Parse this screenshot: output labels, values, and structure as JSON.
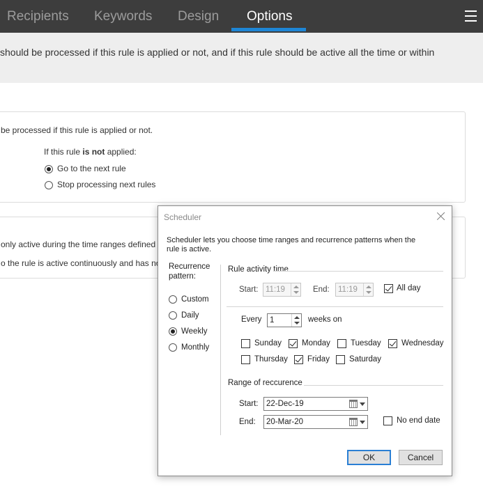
{
  "tabs": [
    {
      "label": "Recipients",
      "active": false
    },
    {
      "label": "Keywords",
      "active": false
    },
    {
      "label": "Design",
      "active": false
    },
    {
      "label": "Options",
      "active": true
    }
  ],
  "description": "should be processed if this rule is applied or not, and if this rule should be active all the time or within",
  "panel1": {
    "text": "be processed if this rule is applied or not.",
    "condition_prefix": "If this rule ",
    "condition_bold": "is not",
    "condition_suffix": " applied:",
    "options": [
      {
        "label": "Go to the next rule",
        "selected": true
      },
      {
        "label": "Stop processing next rules",
        "selected": false
      }
    ]
  },
  "panel2": {
    "line1": "only active during the time ranges defined",
    "line2": "o the rule is active continuously and has no"
  },
  "dialog": {
    "title": "Scheduler",
    "intro": "Scheduler lets you choose time ranges and recurrence patterns when the rule is active.",
    "recurrence_label": "Recurrence pattern:",
    "patterns": [
      {
        "label": "Custom",
        "selected": false
      },
      {
        "label": "Daily",
        "selected": false
      },
      {
        "label": "Weekly",
        "selected": true
      },
      {
        "label": "Monthly",
        "selected": false
      }
    ],
    "activity_time_label": "Rule activity time",
    "start_label": "Start:",
    "start_time": "11:19",
    "end_label": "End:",
    "end_time": "11:19",
    "all_day_label": "All day",
    "all_day_checked": true,
    "every_label": "Every",
    "every_value": "1",
    "weeks_on_label": "weeks on",
    "days": [
      {
        "label": "Sunday",
        "checked": false
      },
      {
        "label": "Monday",
        "checked": true
      },
      {
        "label": "Tuesday",
        "checked": false
      },
      {
        "label": "Wednesday",
        "checked": true
      },
      {
        "label": "Thursday",
        "checked": false
      },
      {
        "label": "Friday",
        "checked": true
      },
      {
        "label": "Saturday",
        "checked": false
      }
    ],
    "range_label": "Range of reccurence",
    "range_start_label": "Start:",
    "range_start_value": "22-Dec-19",
    "range_end_label": "End:",
    "range_end_value": "20-Mar-20",
    "no_end_date_label": "No end date",
    "no_end_date_checked": false,
    "ok_label": "OK",
    "cancel_label": "Cancel"
  },
  "colors": {
    "topbar": "#3d3d3d",
    "tab_active_underline": "#1e86d6",
    "primary_button_border": "#2a7fd4"
  }
}
